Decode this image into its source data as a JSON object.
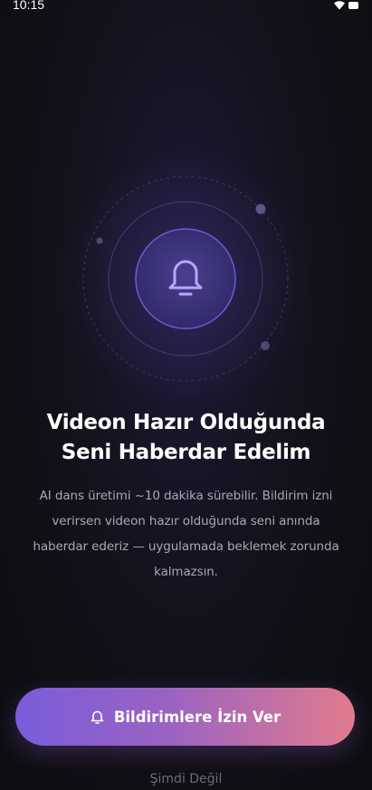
{
  "status_bar": {
    "time": "10:15",
    "wifi_icon": "wifi-icon",
    "battery_icon": "battery-icon"
  },
  "hero": {
    "icon": "bell-icon"
  },
  "title_lines": [
    "Videon Hazır Olduğunda",
    "Seni Haberdar Edelim"
  ],
  "description_lines": [
    "AI dans üretimi ~10 dakika sürebilir. Bildirim izni",
    "verirsen videon hazır olduğunda seni anında",
    "haberdar ederiz — uygulamada beklemek zorunda",
    "kalmazsın."
  ],
  "allow_button": {
    "icon": "bell-icon",
    "label": "Bildirimlere İzin Ver"
  },
  "skip_label": "Şimdi Değil",
  "colors": {
    "accent": "#7a5cdb",
    "gradient_end": "#e27b8d",
    "bell": "#b9a6ff"
  }
}
